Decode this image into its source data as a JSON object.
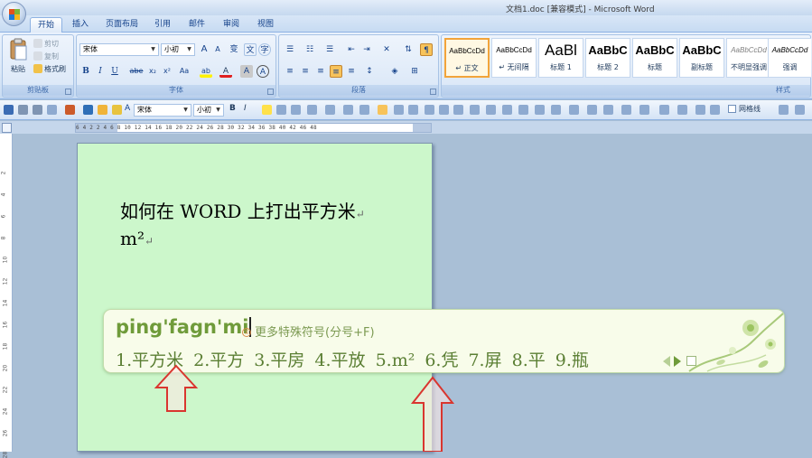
{
  "window": {
    "title": "文档1.doc [兼容模式] - Microsoft Word"
  },
  "tabs": [
    {
      "label": "开始",
      "active": true
    },
    {
      "label": "插入"
    },
    {
      "label": "页面布局"
    },
    {
      "label": "引用"
    },
    {
      "label": "邮件"
    },
    {
      "label": "审阅"
    },
    {
      "label": "视图"
    }
  ],
  "ribbon": {
    "clipboard": {
      "paste": "粘贴",
      "cut": "剪切",
      "copy": "复制",
      "format_painter": "格式刷",
      "group_label": "剪贴板"
    },
    "font": {
      "font_name": "宋体",
      "font_size": "小初",
      "group_label": "字体",
      "grow": "A",
      "shrink": "A",
      "clear": "变",
      "phonetic": "文",
      "bold": "B",
      "italic": "I",
      "underline": "U",
      "strike": "abe",
      "subscript": "x₂",
      "superscript": "x²",
      "case": "Aa",
      "highlight": "ab",
      "color": "A",
      "char_shade": "A",
      "char_border": "A"
    },
    "paragraph": {
      "group_label": "段落"
    },
    "styles": {
      "group_label": "样式",
      "items": [
        {
          "sample": "AaBbCcDd",
          "name": "↵ 正文",
          "selected": true
        },
        {
          "sample": "AaBbCcDd",
          "name": "↵ 无间隔"
        },
        {
          "sample": "AaBl",
          "name": "标题 1"
        },
        {
          "sample": "AaBbC",
          "name": "标题 2"
        },
        {
          "sample": "AaBbC",
          "name": "标题"
        },
        {
          "sample": "AaBbC",
          "name": "副标题"
        },
        {
          "sample": "AaBbCcDd",
          "name": "不明显强调"
        },
        {
          "sample": "AaBbCcDd",
          "name": "强调"
        }
      ]
    }
  },
  "qat": {
    "font_name": "宋体",
    "font_size": "小初",
    "grid_label": "网格线"
  },
  "ruler": {
    "numbers": "6  4  2     2  4  6  8  10 12 14 16 18 20 22 24 26 28 30 32 34 36 38 40 42    46 48",
    "vertical_numbers": [
      "2",
      "4",
      "6",
      "8",
      "10",
      "12",
      "14",
      "16",
      "18",
      "20",
      "22",
      "24",
      "26",
      "28"
    ]
  },
  "document": {
    "line1": "如何在 WORD 上打出平方米",
    "line2": "m²",
    "para_mark": "↵"
  },
  "ime": {
    "composition": "ping'fagn'mi",
    "hint_index": "①",
    "hint": "更多特殊符号(分号+F)",
    "candidates": [
      "1.平方米",
      "2.平方",
      "3.平房",
      "4.平放",
      "5.m²",
      "6.凭",
      "7.屏",
      "8.平",
      "9.瓶"
    ]
  },
  "colors": {
    "page": "#ccf7cb",
    "ime_text": "#6f9b3a",
    "arrow": "#d9362f"
  }
}
